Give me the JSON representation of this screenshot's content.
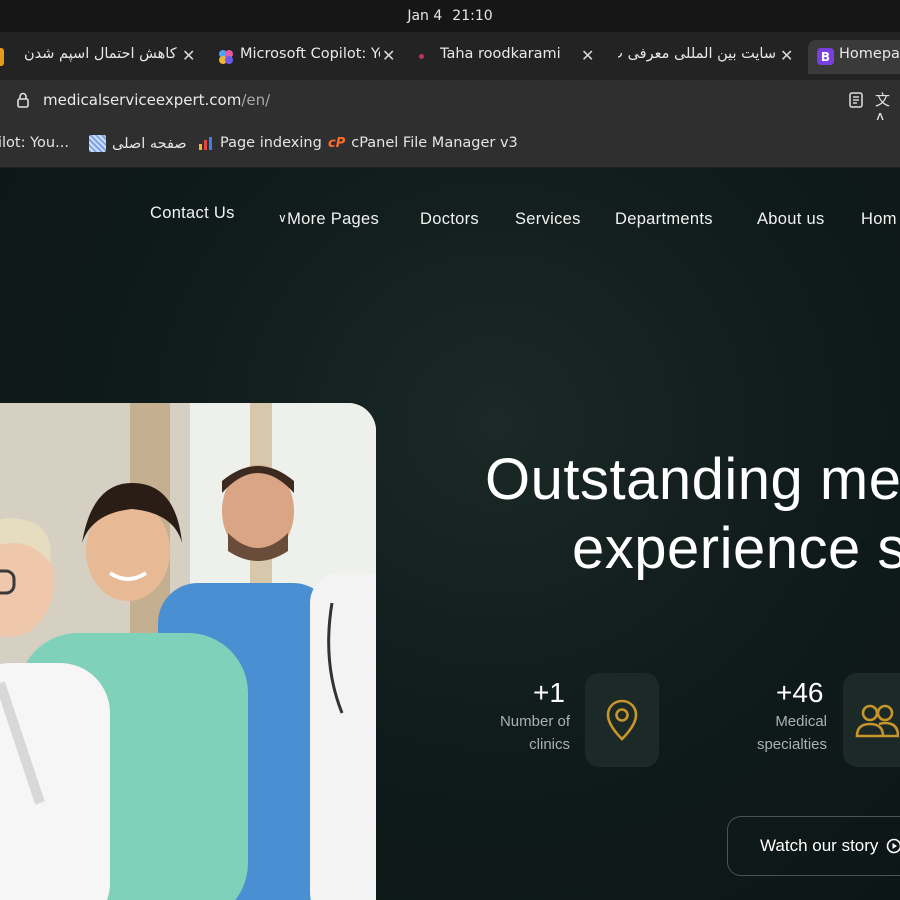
{
  "os": {
    "date": "Jan 4",
    "time": "21:10"
  },
  "tabs": [
    {
      "label": "کاهش احتمال اسپم شدن",
      "icon": "orange-square-icon"
    },
    {
      "label": "Microsoft Copilot: Yo",
      "icon": "copilot-icon"
    },
    {
      "label": "Taha roodkarami",
      "icon": "red-dot-icon"
    },
    {
      "label": "سایت بین المللی معرفی پ",
      "icon": ""
    },
    {
      "label": "Homepag",
      "icon": "bootstrap-b-icon",
      "active": true
    }
  ],
  "address": {
    "host": "medicalserviceexpert.com",
    "path": "/en/"
  },
  "bookmarks": [
    {
      "label": "ilot: You...",
      "icon": ""
    },
    {
      "label": "صفحه اصلی",
      "icon": "grid-favicon-icon"
    },
    {
      "label": "Page indexing",
      "icon": "search-console-icon"
    },
    {
      "label": "cPanel File Manager v3",
      "icon": "cpanel-icon"
    }
  ],
  "nav": {
    "contact": "Contact Us",
    "more_pages": "More Pages",
    "doctors": "Doctors",
    "services": "Services",
    "departments": "Departments",
    "about": "About us",
    "home": "Hom"
  },
  "hero": {
    "line1": "Outstanding me",
    "line2": "experience s"
  },
  "stats": [
    {
      "number": "+1",
      "label_line1": "Number of",
      "label_line2": "clinics",
      "icon": "location-pin-icon"
    },
    {
      "number": "+46",
      "label_line1": "Medical",
      "label_line2": "specialties",
      "icon": "users-icon"
    }
  ],
  "cta": {
    "label": "Watch our story"
  },
  "colors": {
    "accent": "#c8952b",
    "page_bg": "#0f1b1a"
  }
}
